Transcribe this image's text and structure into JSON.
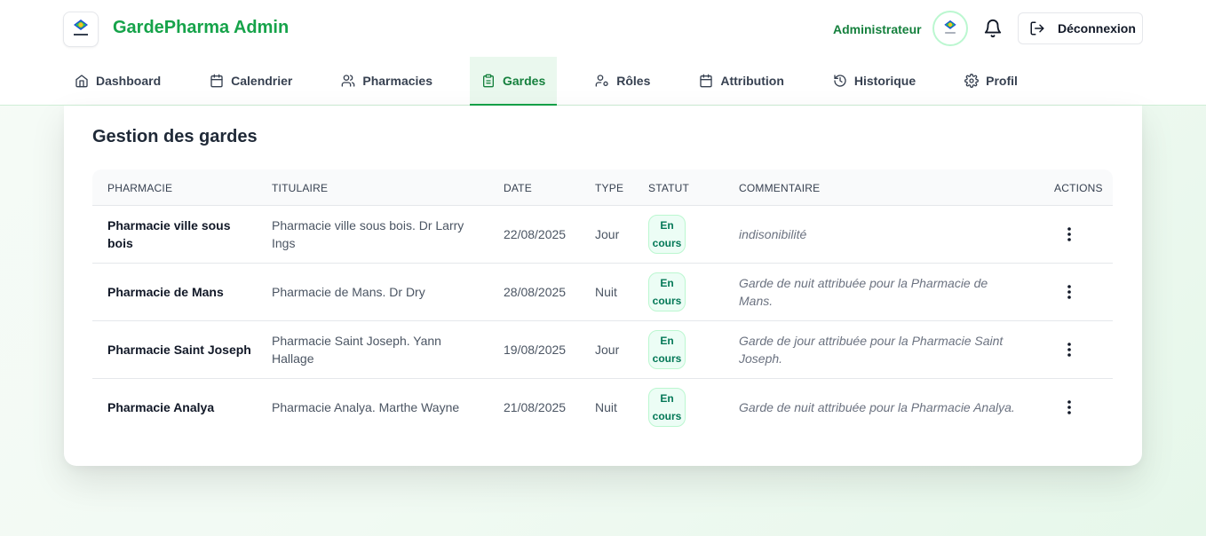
{
  "header": {
    "app_title": "GardePharma Admin",
    "user_label": "Administrateur",
    "logout_label": "Déconnexion"
  },
  "nav": {
    "items": [
      {
        "label": "Dashboard",
        "icon": "home-icon"
      },
      {
        "label": "Calendrier",
        "icon": "calendar-icon"
      },
      {
        "label": "Pharmacies",
        "icon": "users-icon"
      },
      {
        "label": "Gardes",
        "icon": "clipboard-icon",
        "active": true
      },
      {
        "label": "Rôles",
        "icon": "user-cog-icon"
      },
      {
        "label": "Attribution",
        "icon": "calendar-icon"
      },
      {
        "label": "Historique",
        "icon": "history-icon"
      },
      {
        "label": "Profil",
        "icon": "gear-icon"
      }
    ]
  },
  "page": {
    "title": "Gestion des gardes"
  },
  "table": {
    "columns": [
      "PHARMACIE",
      "TITULAIRE",
      "DATE",
      "TYPE",
      "STATUT",
      "COMMENTAIRE",
      "ACTIONS"
    ],
    "rows": [
      {
        "pharmacie": "Pharmacie ville sous bois",
        "titulaire": "Pharmacie ville sous bois. Dr Larry Ings",
        "date": "22/08/2025",
        "type": "Jour",
        "statut_1": "En",
        "statut_2": "cours",
        "commentaire": "indisonibilité"
      },
      {
        "pharmacie": "Pharmacie de Mans",
        "titulaire": "Pharmacie de Mans. Dr Dry",
        "date": "28/08/2025",
        "type": "Nuit",
        "statut_1": "En",
        "statut_2": "cours",
        "commentaire": "Garde de nuit attribuée pour la Pharmacie de Mans."
      },
      {
        "pharmacie": "Pharmacie Saint Joseph",
        "titulaire": "Pharmacie Saint Joseph. Yann Hallage",
        "date": "19/08/2025",
        "type": "Jour",
        "statut_1": "En",
        "statut_2": "cours",
        "commentaire": "Garde de jour attribuée pour la Pharmacie Saint Joseph."
      },
      {
        "pharmacie": "Pharmacie Analya",
        "titulaire": "Pharmacie Analya. Marthe Wayne",
        "date": "21/08/2025",
        "type": "Nuit",
        "statut_1": "En",
        "statut_2": "cours",
        "commentaire": "Garde de nuit attribuée pour la Pharmacie Analya."
      }
    ]
  },
  "colors": {
    "brand": "#16a34a",
    "active_tab_bg": "#eaf8ee",
    "badge_bg": "#ecfdf5",
    "badge_text": "#047857"
  }
}
